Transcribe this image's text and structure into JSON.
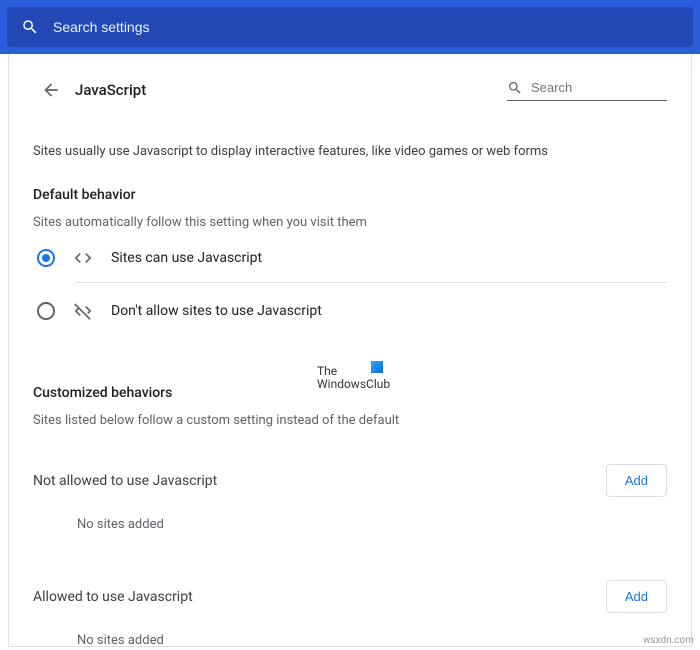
{
  "topSearch": {
    "placeholder": "Search settings"
  },
  "header": {
    "title": "JavaScript",
    "searchPlaceholder": "Search"
  },
  "description": "Sites usually use Javascript to display interactive features, like video games or web forms",
  "defaultBehavior": {
    "heading": "Default behavior",
    "sub": "Sites automatically follow this setting when you visit them",
    "options": [
      {
        "label": "Sites can use Javascript",
        "selected": true
      },
      {
        "label": "Don't allow sites to use Javascript",
        "selected": false
      }
    ]
  },
  "watermark": {
    "line1": "The",
    "line2": "WindowsClub"
  },
  "custom": {
    "heading": "Customized behaviors",
    "sub": "Sites listed below follow a custom setting instead of the default",
    "blocked": {
      "title": "Not allowed to use Javascript",
      "button": "Add",
      "empty": "No sites added"
    },
    "allowed": {
      "title": "Allowed to use Javascript",
      "button": "Add",
      "empty": "No sites added"
    }
  },
  "credit": "wsxdn.com"
}
